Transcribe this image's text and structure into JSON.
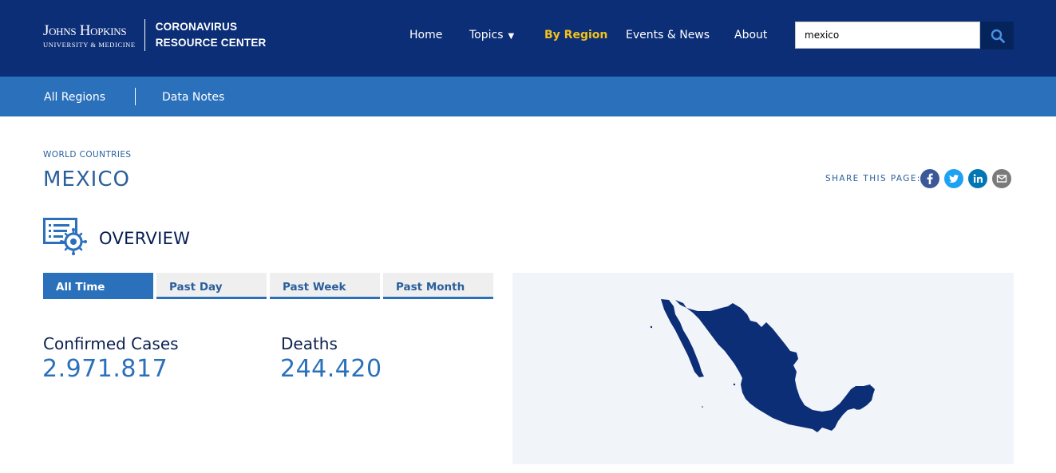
{
  "header": {
    "logo": {
      "line1": "Johns Hopkins",
      "line2": "University & Medicine",
      "crc_line1": "CORONAVIRUS",
      "crc_line2": "RESOURCE CENTER"
    },
    "nav": [
      {
        "label": "Home"
      },
      {
        "label": "Topics"
      },
      {
        "label": "By Region",
        "active": true
      },
      {
        "label": "Events & News"
      },
      {
        "label": "About"
      }
    ],
    "search": {
      "value": "mexico"
    }
  },
  "subnav": {
    "items": [
      {
        "label": "All Regions"
      },
      {
        "label": "Data Notes"
      }
    ]
  },
  "page": {
    "eyebrow": "WORLD COUNTRIES",
    "title": "MEXICO",
    "share_label": "SHARE THIS PAGE:",
    "share_icons": [
      "facebook-icon",
      "twitter-icon",
      "linkedin-icon",
      "email-icon"
    ]
  },
  "overview": {
    "title": "OVERVIEW",
    "tabs": [
      {
        "label": "All Time",
        "active": true
      },
      {
        "label": "Past Day"
      },
      {
        "label": "Past Week"
      },
      {
        "label": "Past Month"
      }
    ],
    "stats": [
      {
        "label": "Confirmed Cases",
        "value": "2.971.817"
      },
      {
        "label": "Deaths",
        "value": "244.420"
      }
    ]
  },
  "colors": {
    "header_bg": "#0b2e76",
    "subnav_bg": "#2a70ba",
    "active_nav": "#f3c21a",
    "map_fill": "#0b2e76",
    "map_bg": "#f1f4f8"
  }
}
